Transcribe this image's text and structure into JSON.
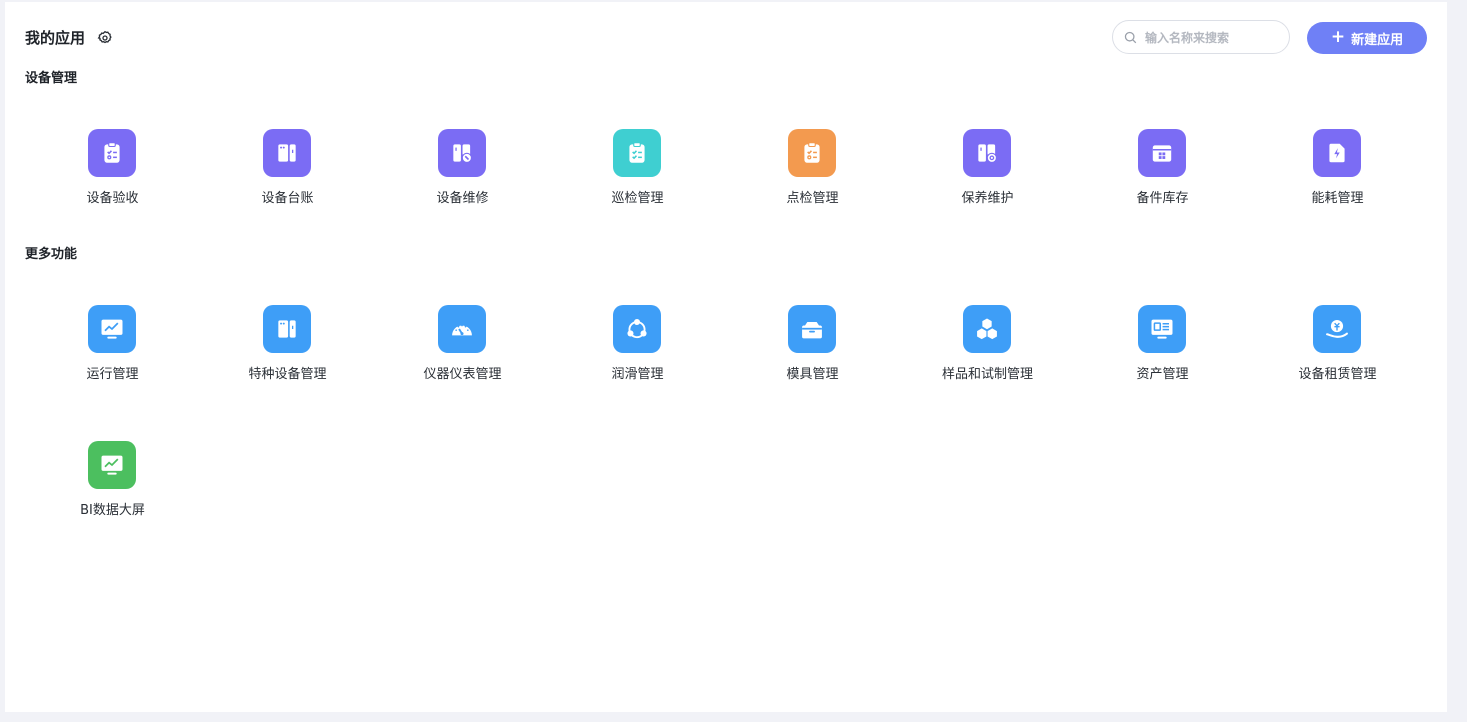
{
  "header": {
    "title": "我的应用",
    "search_placeholder": "输入名称来搜索",
    "new_button_label": "新建应用"
  },
  "sections": [
    {
      "title": "设备管理",
      "apps": [
        {
          "label": "设备验收",
          "icon": "clipboard-check-icon",
          "color": "#7b6cf4"
        },
        {
          "label": "设备台账",
          "icon": "cabinet-icon",
          "color": "#7b6cf4"
        },
        {
          "label": "设备维修",
          "icon": "cabinet-wrench-icon",
          "color": "#7b6cf4"
        },
        {
          "label": "巡检管理",
          "icon": "clipboard-list-icon",
          "color": "#3fcfd1"
        },
        {
          "label": "点检管理",
          "icon": "clipboard-check-icon",
          "color": "#f39a4f"
        },
        {
          "label": "保养维护",
          "icon": "cabinet-gear-icon",
          "color": "#7b6cf4"
        },
        {
          "label": "备件库存",
          "icon": "warehouse-icon",
          "color": "#7b6cf4"
        },
        {
          "label": "能耗管理",
          "icon": "energy-file-icon",
          "color": "#7b6cf4"
        }
      ]
    },
    {
      "title": "更多功能",
      "apps": [
        {
          "label": "运行管理",
          "icon": "monitor-chart-icon",
          "color": "#3e9ef7"
        },
        {
          "label": "特种设备管理",
          "icon": "cabinet-icon",
          "color": "#3e9ef7"
        },
        {
          "label": "仪器仪表管理",
          "icon": "gauge-icon",
          "color": "#3e9ef7"
        },
        {
          "label": "润滑管理",
          "icon": "cycle-icon",
          "color": "#3e9ef7"
        },
        {
          "label": "模具管理",
          "icon": "toolbox-icon",
          "color": "#3e9ef7"
        },
        {
          "label": "样品和试制管理",
          "icon": "cubes-icon",
          "color": "#3e9ef7"
        },
        {
          "label": "资产管理",
          "icon": "asset-screen-icon",
          "color": "#3e9ef7"
        },
        {
          "label": "设备租赁管理",
          "icon": "hand-coin-icon",
          "color": "#3e9ef7"
        },
        {
          "label": "BI数据大屏",
          "icon": "monitor-chart-icon",
          "color": "#4cbf5f"
        }
      ]
    }
  ]
}
